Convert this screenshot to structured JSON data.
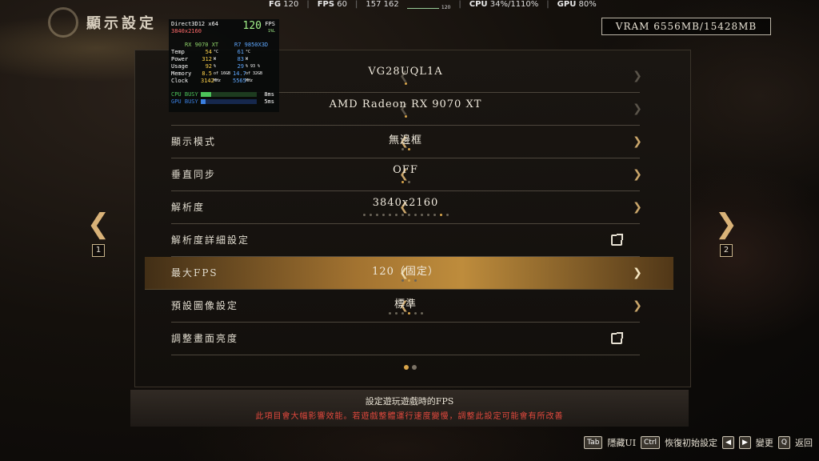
{
  "page_title": "顯示設定",
  "perf_bar": {
    "fg_label": "FG",
    "fg_value": "120",
    "fps_label": "FPS",
    "fps_value": "60",
    "frametime": "157 162",
    "graph_caption": "120",
    "cpu_label": "CPU",
    "cpu_value": "34%/1110%",
    "gpu_label": "GPU",
    "gpu_value": "80%"
  },
  "vram": "VRAM 6556MB/15428MB",
  "osd": {
    "api": "Direct3D12 x64",
    "resolution": "3840x2160",
    "fps": "120",
    "fps_label": "FPS",
    "fps_sub": "1%L",
    "gpu_name": "RX 9070 XT",
    "cpu_name": "R7 9850X3D",
    "rows": [
      {
        "label": "Temp",
        "gpu": "54",
        "gpu_unit": "°C",
        "cpu": "61",
        "cpu_unit": "°C"
      },
      {
        "label": "Power",
        "gpu": "312",
        "gpu_unit": "W",
        "cpu": "83",
        "cpu_unit": "W"
      },
      {
        "label": "Usage",
        "gpu": "92",
        "gpu_unit": "%",
        "cpu": "29",
        "cpu_unit": "% 93 %"
      },
      {
        "label": "Memory",
        "gpu": "8.5",
        "gpu_unit": "of 16GB",
        "cpu": "14.7",
        "cpu_unit": "of 32GB"
      },
      {
        "label": "Clock",
        "gpu": "3142",
        "gpu_unit": "MHz",
        "cpu": "5565",
        "cpu_unit": "MHz"
      }
    ],
    "cpu_busy_label": "CPU BUSY",
    "cpu_busy_value": "8ms",
    "cpu_busy_fraction": 0.18,
    "gpu_busy_label": "GPU BUSY",
    "gpu_busy_value": "5ms",
    "gpu_busy_fraction": 0.09
  },
  "settings": [
    {
      "label": "",
      "value": "VG28UQL1A",
      "dots": 1,
      "selected_dot": 0
    },
    {
      "label": "",
      "value": "AMD Radeon RX 9070 XT",
      "dots": 1,
      "selected_dot": 0
    },
    {
      "label": "顯示模式",
      "value": "無邊框",
      "dots": 2,
      "selected_dot": 1
    },
    {
      "label": "垂直同步",
      "value": "OFF",
      "dots": 2,
      "selected_dot": 0
    },
    {
      "label": "解析度",
      "value": "3840x2160",
      "dots": 14,
      "selected_dot": 12
    },
    {
      "label": "解析度詳細設定",
      "value": "",
      "dots": 0,
      "selected_dot": -1,
      "external": true
    },
    {
      "label": "最大FPS",
      "value": "120（固定）",
      "dots": 3,
      "selected_dot": 1
    },
    {
      "label": "預設圖像設定",
      "value": "標準",
      "dots": 6,
      "selected_dot": 3
    },
    {
      "label": "調整畫面亮度",
      "value": "",
      "dots": 0,
      "selected_dot": -1,
      "external": true
    }
  ],
  "pager": {
    "left_key": "1",
    "right_key": "2",
    "pages": 2,
    "current": 0
  },
  "description": {
    "title": "設定遊玩遊戲時的FPS",
    "warning": "此項目會大幅影響效能。若遊戲整體運行速度變慢，調整此設定可能會有所改善"
  },
  "footer": {
    "tab_key": "Tab",
    "tab_label": "隱藏UI",
    "ctrl_key": "Ctrl",
    "ctrl_label": "恢復初始設定",
    "change_label": "變更",
    "q_key": "Q",
    "q_label": "返回"
  },
  "colors": {
    "accent": "#d9a54a",
    "warning": "#e0483d",
    "highlight": "#be8c3c"
  }
}
